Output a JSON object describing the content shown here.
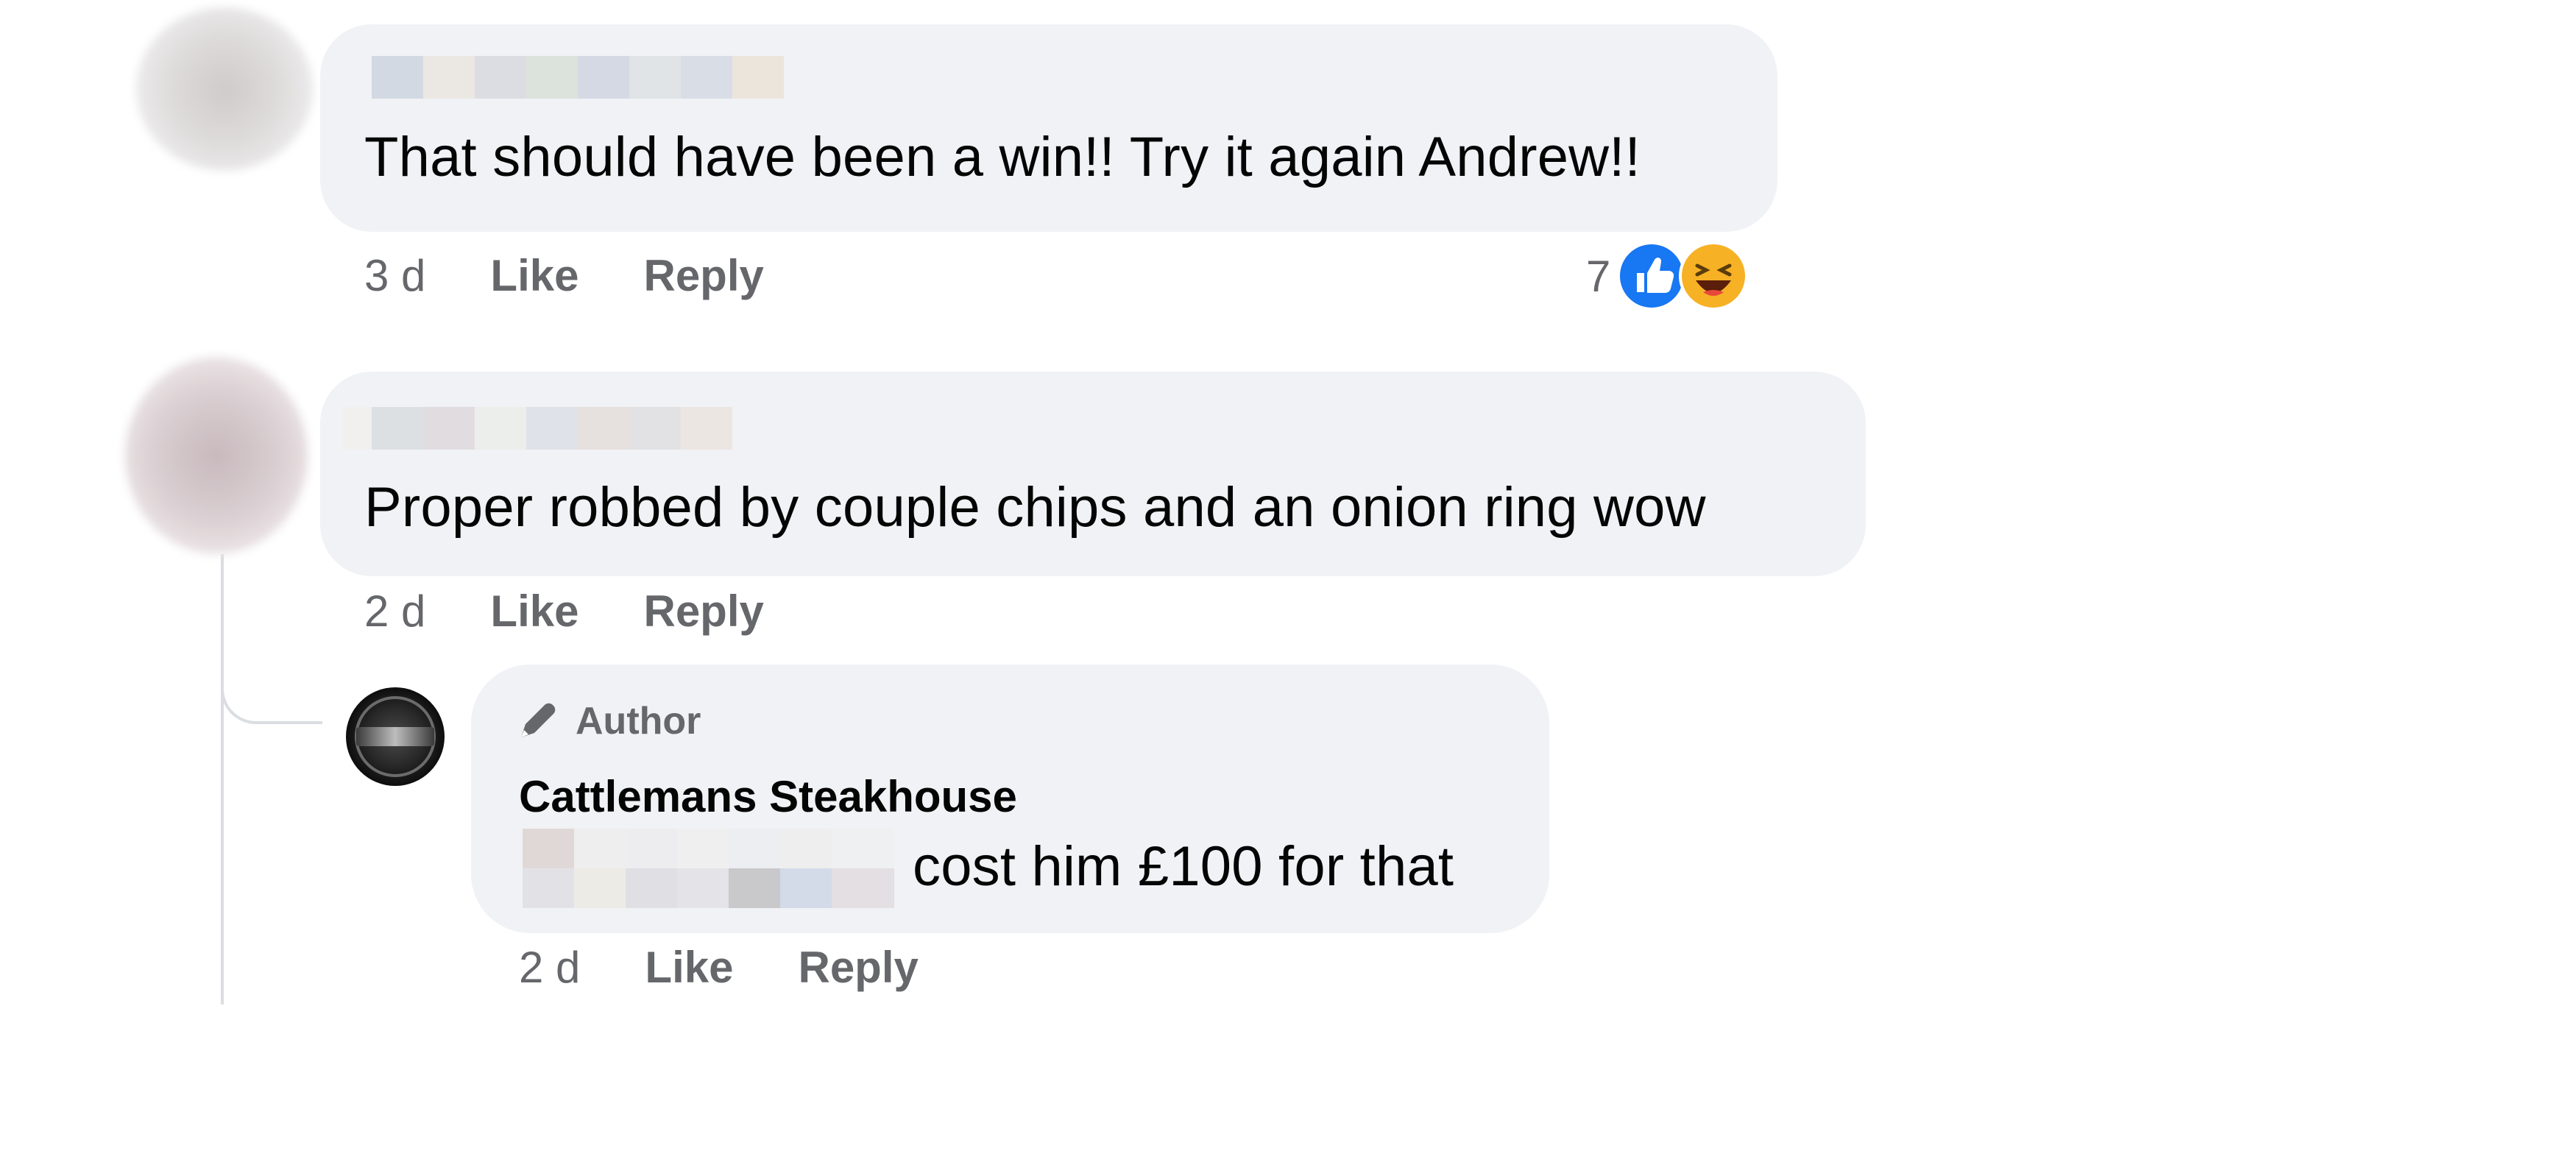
{
  "comments": [
    {
      "text": "That should have been a win!! Try it again Andrew!!",
      "time": "3 d",
      "like_label": "Like",
      "reply_label": "Reply",
      "reactions": {
        "count": "7",
        "icons": [
          "like-icon",
          "haha-icon"
        ]
      }
    },
    {
      "text": "Proper robbed by couple chips and an onion ring wow",
      "time": "2 d",
      "like_label": "Like",
      "reply_label": "Reply",
      "replies": [
        {
          "badge": "Author",
          "badge_icon": "pen-icon",
          "name": "Cattlemans Steakhouse",
          "text": "cost him £100 for that",
          "time": "2 d",
          "like_label": "Like",
          "reply_label": "Reply"
        }
      ]
    }
  ],
  "colors": {
    "bubble": "#f0f2f5",
    "meta_text": "#65676b",
    "like_blue": "#1877f2",
    "haha_yellow": "#f7b125",
    "thread_line": "#dadde1"
  }
}
